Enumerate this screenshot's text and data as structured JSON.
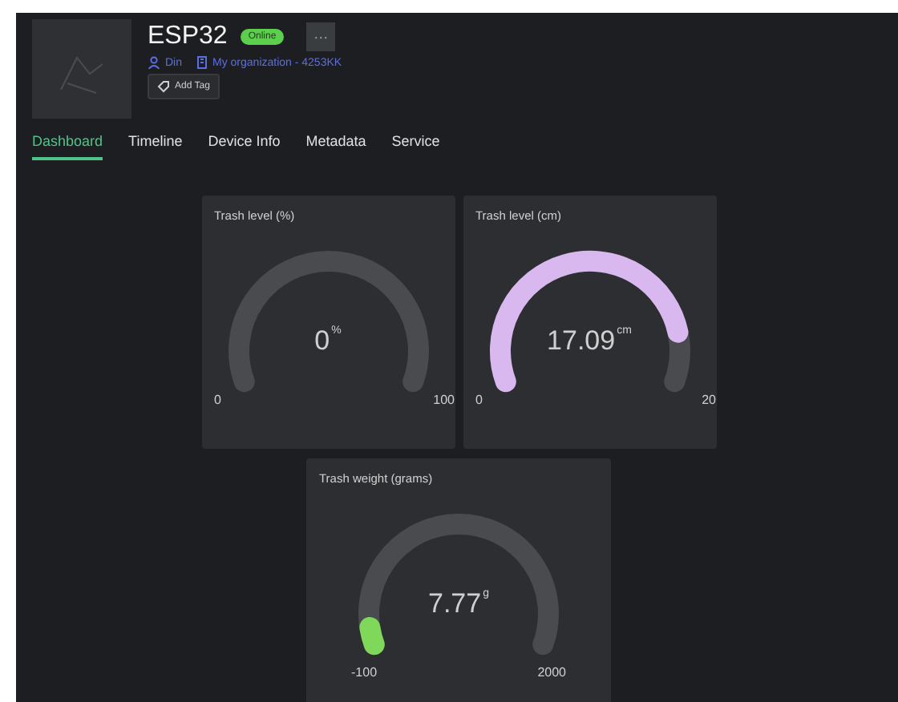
{
  "device": {
    "name": "ESP32",
    "status": "Online",
    "more": "···",
    "owner": "Din",
    "organization": "My organization - 4253KK",
    "add_tag": "Add Tag"
  },
  "tabs": [
    {
      "label": "Dashboard",
      "selected": true
    },
    {
      "label": "Timeline",
      "selected": false
    },
    {
      "label": "Device Info",
      "selected": false
    },
    {
      "label": "Metadata",
      "selected": false
    },
    {
      "label": "Service",
      "selected": false
    }
  ],
  "widgets": [
    {
      "title": "Trash level (%)",
      "value": "0",
      "unit": "%",
      "min": "0",
      "max": "100"
    },
    {
      "title": "Trash level (cm)",
      "value": "17.09",
      "unit": "cm",
      "min": "0",
      "max": "20"
    },
    {
      "title": "Trash weight (grams)",
      "value": "7.77",
      "unit": "g",
      "min": "-100",
      "max": "2000"
    }
  ]
}
